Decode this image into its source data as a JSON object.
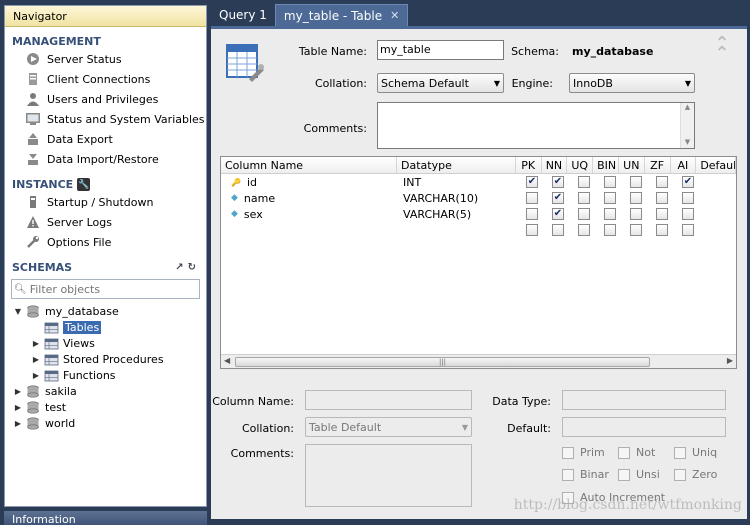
{
  "navigator": {
    "title": "Navigator",
    "management": {
      "title": "MANAGEMENT",
      "items": [
        {
          "label": "Server Status",
          "icon": "server-status-icon"
        },
        {
          "label": "Client Connections",
          "icon": "client-connections-icon"
        },
        {
          "label": "Users and Privileges",
          "icon": "users-icon"
        },
        {
          "label": "Status and System Variables",
          "icon": "variables-icon"
        },
        {
          "label": "Data Export",
          "icon": "export-icon"
        },
        {
          "label": "Data Import/Restore",
          "icon": "import-icon"
        }
      ]
    },
    "instance": {
      "title": "INSTANCE",
      "items": [
        {
          "label": "Startup / Shutdown",
          "icon": "startup-icon"
        },
        {
          "label": "Server Logs",
          "icon": "warning-icon"
        },
        {
          "label": "Options File",
          "icon": "wrench-icon"
        }
      ]
    },
    "schemas": {
      "title": "SCHEMAS",
      "filter_placeholder": "Filter objects",
      "tree": {
        "db": "my_database",
        "children": [
          "Tables",
          "Views",
          "Stored Procedures",
          "Functions"
        ],
        "others": [
          "sakila",
          "test",
          "world"
        ]
      }
    },
    "info_tab": "Information"
  },
  "tabs": [
    {
      "label": "Query 1"
    },
    {
      "label": "my_table - Table"
    }
  ],
  "editor": {
    "table_name_label": "Table Name:",
    "table_name": "my_table",
    "schema_label": "Schema:",
    "schema": "my_database",
    "collation_label": "Collation:",
    "collation": "Schema Default",
    "engine_label": "Engine:",
    "engine": "InnoDB",
    "comments_label": "Comments:",
    "columns": {
      "headers": [
        "Column Name",
        "Datatype",
        "PK",
        "NN",
        "UQ",
        "BIN",
        "UN",
        "ZF",
        "AI",
        "Default"
      ],
      "rows": [
        {
          "name": "id",
          "type": "INT",
          "key": true,
          "flags": [
            true,
            true,
            false,
            false,
            false,
            false,
            true
          ]
        },
        {
          "name": "name",
          "type": "VARCHAR(10)",
          "key": false,
          "flags": [
            false,
            true,
            false,
            false,
            false,
            false,
            false
          ]
        },
        {
          "name": "sex",
          "type": "VARCHAR(5)",
          "key": false,
          "flags": [
            false,
            true,
            false,
            false,
            false,
            false,
            false
          ]
        }
      ]
    },
    "detail": {
      "column_name_label": "Column Name:",
      "data_type_label": "Data Type:",
      "collation_label": "Collation:",
      "collation": "Table Default",
      "default_label": "Default:",
      "comments_label": "Comments:",
      "checks": [
        "Prim",
        "Not",
        "Uniq",
        "Binar",
        "Unsi",
        "Zero",
        "Auto Increment"
      ]
    }
  },
  "watermark": "http://blog.csdn.net/wtfmonking"
}
